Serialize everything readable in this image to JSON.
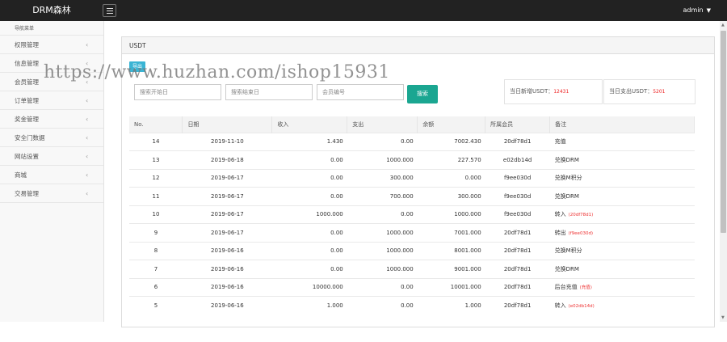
{
  "header": {
    "brand": "DRM森林",
    "user": "admin"
  },
  "sidebar": {
    "heading": "导航菜单",
    "items": [
      {
        "label": "权限管理"
      },
      {
        "label": "信息管理"
      },
      {
        "label": "会员管理"
      },
      {
        "label": "订单管理"
      },
      {
        "label": "奖金管理"
      },
      {
        "label": "安全门数据"
      },
      {
        "label": "网站设置"
      },
      {
        "label": "商城"
      },
      {
        "label": "交易管理"
      }
    ]
  },
  "panel": {
    "title": "USDT",
    "export_label": "导出"
  },
  "watermark": "https://www.huzhan.com/ishop15931",
  "filters": {
    "start_date_placeholder": "搜索开始日",
    "end_date_placeholder": "搜索结束日",
    "member_placeholder": "会员编号",
    "search_label": "搜索"
  },
  "stats": {
    "new_label": "当日新增USDT：",
    "new_value": "12431",
    "out_label": "当日支出USDT：",
    "out_value": "5201"
  },
  "table": {
    "headers": [
      "No.",
      "日期",
      "收入",
      "支出",
      "余额",
      "所属会员",
      "备注"
    ],
    "rows": [
      {
        "no": "14",
        "date": "2019-11-10",
        "income": "1.430",
        "expense": "0.00",
        "balance": "7002.430",
        "member": "20df78d1",
        "note": "充值",
        "note_extra": ""
      },
      {
        "no": "13",
        "date": "2019-06-18",
        "income": "0.00",
        "expense": "1000.000",
        "balance": "227.570",
        "member": "e02db14d",
        "note": "兑换DRM",
        "note_extra": ""
      },
      {
        "no": "12",
        "date": "2019-06-17",
        "income": "0.00",
        "expense": "300.000",
        "balance": "0.000",
        "member": "f9ee030d",
        "note": "兑换M积分",
        "note_extra": ""
      },
      {
        "no": "11",
        "date": "2019-06-17",
        "income": "0.00",
        "expense": "700.000",
        "balance": "300.000",
        "member": "f9ee030d",
        "note": "兑换DRM",
        "note_extra": ""
      },
      {
        "no": "10",
        "date": "2019-06-17",
        "income": "1000.000",
        "expense": "0.00",
        "balance": "1000.000",
        "member": "f9ee030d",
        "note": "转入",
        "note_extra": "(20df78d1)"
      },
      {
        "no": "9",
        "date": "2019-06-17",
        "income": "0.00",
        "expense": "1000.000",
        "balance": "7001.000",
        "member": "20df78d1",
        "note": "转出",
        "note_extra": "(f9ee030d)"
      },
      {
        "no": "8",
        "date": "2019-06-16",
        "income": "0.00",
        "expense": "1000.000",
        "balance": "8001.000",
        "member": "20df78d1",
        "note": "兑换M积分",
        "note_extra": ""
      },
      {
        "no": "7",
        "date": "2019-06-16",
        "income": "0.00",
        "expense": "1000.000",
        "balance": "9001.000",
        "member": "20df78d1",
        "note": "兑换DRM",
        "note_extra": ""
      },
      {
        "no": "6",
        "date": "2019-06-16",
        "income": "10000.000",
        "expense": "0.00",
        "balance": "10001.000",
        "member": "20df78d1",
        "note": "后台充值",
        "note_extra": "(充值)"
      },
      {
        "no": "5",
        "date": "2019-06-16",
        "income": "1.000",
        "expense": "0.00",
        "balance": "1.000",
        "member": "20df78d1",
        "note": "转入",
        "note_extra": "(e02db14d)"
      }
    ]
  },
  "colors": {
    "topbar": "#222222",
    "accent_teal": "#1aa691",
    "export_blue": "#3ab4d4",
    "highlight_red": "#ee2222"
  }
}
